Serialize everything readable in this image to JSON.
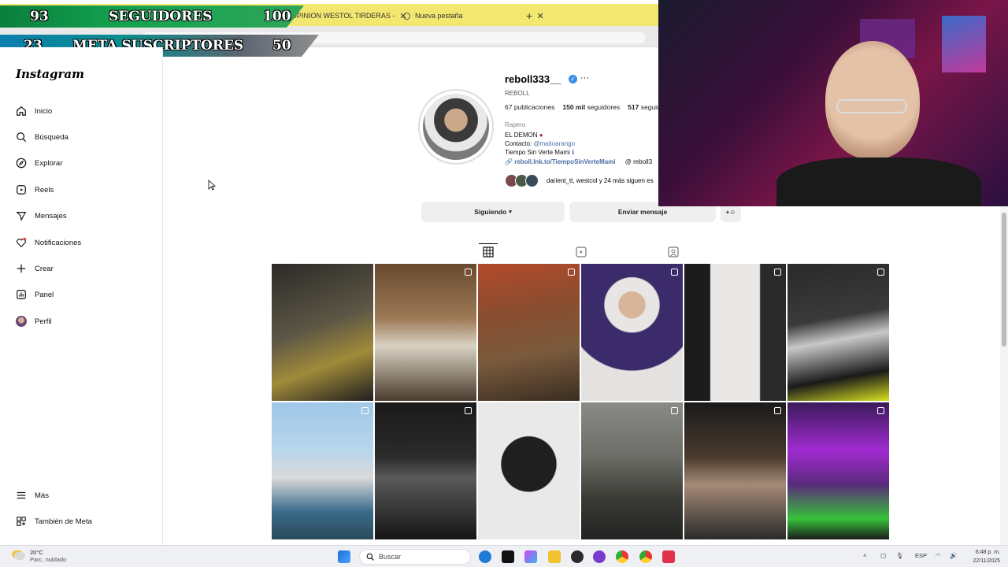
{
  "browser": {
    "tabs": [
      {
        "label": "OPINION WESTOL TIRDERAS -"
      },
      {
        "label": "Nueva pestaña"
      }
    ],
    "new_tab_label": "+"
  },
  "overlay": {
    "followers_bar": {
      "current": "93",
      "label": "SEGUIDORES",
      "goal": "100"
    },
    "subs_bar": {
      "current": "23",
      "label": "META SUSCRIPTORES",
      "goal": "50"
    }
  },
  "sidebar": {
    "logo": "Instagram",
    "items": [
      {
        "label": "Inicio",
        "icon": "home-icon"
      },
      {
        "label": "Búsqueda",
        "icon": "search-icon"
      },
      {
        "label": "Explorar",
        "icon": "compass-icon"
      },
      {
        "label": "Reels",
        "icon": "reels-icon"
      },
      {
        "label": "Mensajes",
        "icon": "send-icon"
      },
      {
        "label": "Notificaciones",
        "icon": "heart-icon"
      },
      {
        "label": "Crear",
        "icon": "plus-icon"
      },
      {
        "label": "Panel",
        "icon": "chart-icon"
      },
      {
        "label": "Perfil",
        "icon": "avatar-icon"
      }
    ],
    "footer": [
      {
        "label": "Más",
        "icon": "menu-icon"
      },
      {
        "label": "También de Meta",
        "icon": "meta-icon"
      }
    ]
  },
  "profile": {
    "username": "reboll333__",
    "full_name": "REBOLL",
    "stats": {
      "posts_num": "67",
      "posts_label": "publicaciones",
      "followers_num": "150 mil",
      "followers_label": "seguidores",
      "following_num": "517",
      "following_label": "seguidos"
    },
    "category": "Rapero",
    "bio_line1": "EL DEMON",
    "bio_contact_label": "Contacto:",
    "bio_contact_handle": "@maitoarango",
    "bio_line3": "Tiempo Sin Verte Mami",
    "link": "reboll.lnk.to/TiempoSinVerteMami",
    "threads": "reboll3",
    "followed_by": "darient_tt, westcol y 24 más siguen es",
    "follow_button": "Siguiendo",
    "message_button": "Enviar mensaje"
  },
  "colors": {
    "verified": "#3b8fe6",
    "link": "#4a6fa5",
    "tabbar": "#f3e770"
  },
  "taskbar": {
    "temperature": "20°C",
    "condition": "Parc. nublado",
    "search_placeholder": "Buscar",
    "language": "ESP",
    "time": "6:48 p. m.",
    "date": "22/11/2025"
  }
}
